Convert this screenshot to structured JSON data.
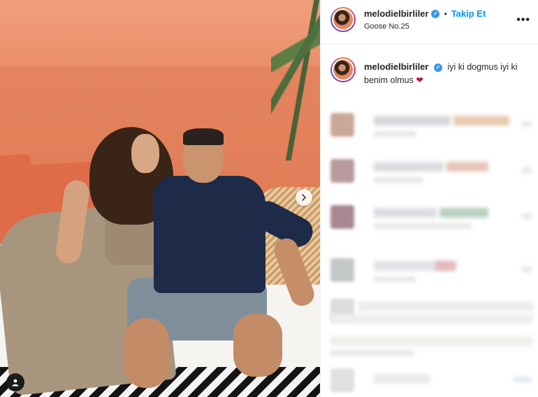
{
  "post": {
    "username": "melodielbirliler",
    "follow_label": "Takip Et",
    "location": "Goose No.25",
    "more_label": "•••",
    "separator": "•",
    "verified_mark": "✓",
    "icons": {
      "verified": "verified-badge-icon",
      "more": "more-options-icon",
      "next": "chevron-right-icon",
      "tag": "user-tag-icon",
      "heart": "red-heart-emoji"
    }
  },
  "caption": {
    "username": "melodielbirliler",
    "text": "iyi ki dogmus iyi ki benim olmus",
    "emoji": "❤"
  },
  "colors": {
    "link": "#0095f6",
    "verified": "#3897f0",
    "text": "#262626",
    "heart": "#c4122f"
  }
}
